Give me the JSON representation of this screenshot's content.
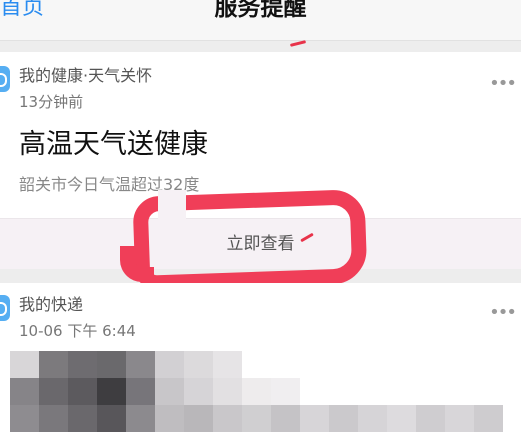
{
  "navbar": {
    "back_label": "首页",
    "title": "服务提醒"
  },
  "notifications": [
    {
      "source": "我的健康·天气关怀",
      "time": "13分钟前",
      "headline": "高温天气送健康",
      "detail": "韶关市今日气温超过32度",
      "action_label": "立即查看",
      "icon": "health-app-icon",
      "more_icon": "more-dots-icon"
    },
    {
      "source": "我的快递",
      "time": "10-06 下午 6:44",
      "icon": "express-app-icon",
      "more_icon": "more-dots-icon",
      "content": "pixelated-obscured-content"
    }
  ],
  "colors": {
    "accent_blue": "#2a8cf0",
    "annotation_red": "#f03e58",
    "background": "#ededed",
    "card": "#ffffff"
  }
}
